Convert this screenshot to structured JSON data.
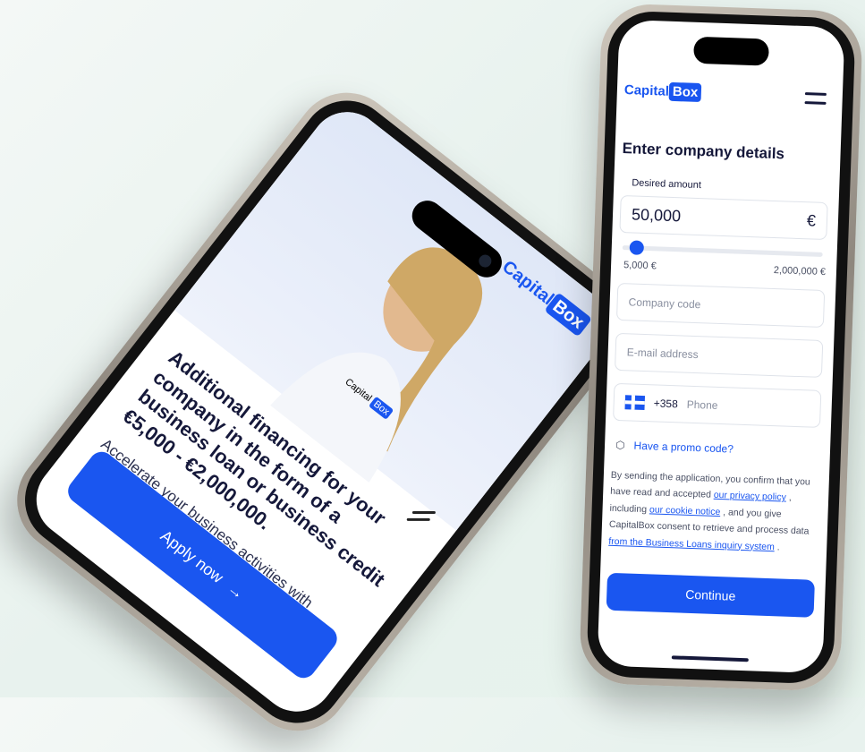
{
  "left_phone": {
    "logo_left": "Capital",
    "logo_right": "Box",
    "badge_left": "Capital",
    "badge_right": "Box",
    "headline": "Additional financing for your company in the form of a business loan or business credit €5,000 - €2,000,000.",
    "subheadline": "Accelerate your business activities with secured or unsecured business financing",
    "cta_label": "Apply now",
    "cta_arrow": "→"
  },
  "right_phone": {
    "logo_left": "Capital",
    "logo_right": "Box",
    "title": "Enter company details",
    "amount_label": "Desired amount",
    "amount_value": "50,000",
    "currency": "€",
    "slider": {
      "min_label": "5,000 €",
      "max_label": "2,000,000 €",
      "value": 50000,
      "min": 5000,
      "max": 2000000
    },
    "company_code_placeholder": "Company code",
    "email_placeholder": "E-mail address",
    "phone_prefix": "+358",
    "phone_placeholder": "Phone",
    "promo_label": "Have a promo code?",
    "consent": {
      "part1": "By sending the application, you confirm that you have read and accepted ",
      "privacy_link": "our privacy policy",
      "part2": " , including ",
      "cookie_link": "our cookie notice",
      "part3": " , and you give CapitalBox consent to retrieve and process data ",
      "registry_link": "from the Business Loans inquiry system",
      "part4": " ."
    },
    "continue_label": "Continue"
  },
  "colors": {
    "accent": "#1a56f0",
    "text_dark": "#15183a"
  }
}
